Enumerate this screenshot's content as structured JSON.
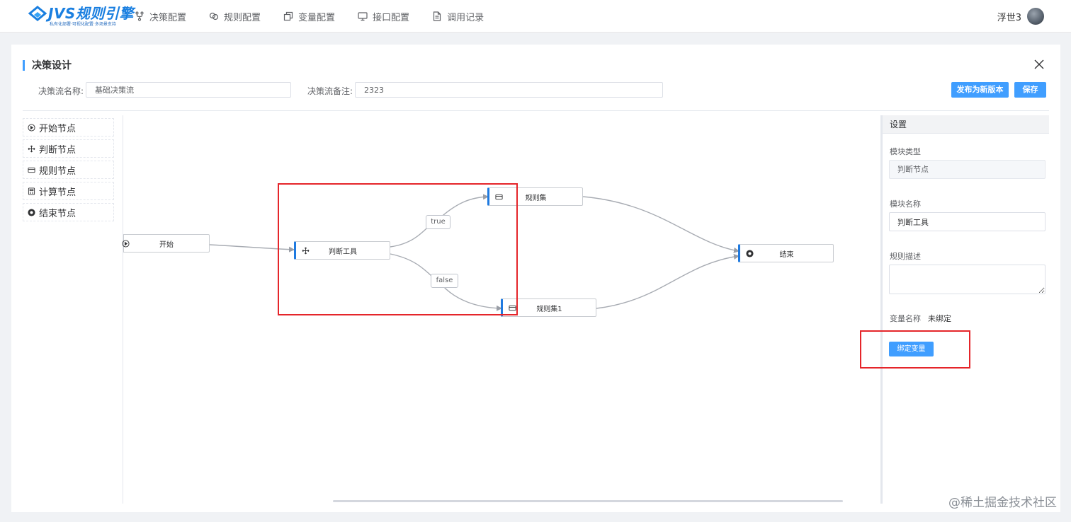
{
  "header": {
    "logo_title": "JVS规则引擎",
    "logo_subtitle": "私有化部署·可视化配置·多场景支持",
    "nav": [
      {
        "label": "决策配置",
        "icon": "fork-icon"
      },
      {
        "label": "规则配置",
        "icon": "link-icon"
      },
      {
        "label": "变量配置",
        "icon": "layers-icon"
      },
      {
        "label": "接口配置",
        "icon": "monitor-icon"
      },
      {
        "label": "调用记录",
        "icon": "document-icon"
      }
    ],
    "user_name": "浮世3"
  },
  "dialog": {
    "title": "决策设计",
    "flow_name_label": "决策流名称:",
    "flow_name_value": "基础决策流",
    "flow_note_label": "决策流备注:",
    "flow_note_value": "2323",
    "publish_label": "发布为新版本",
    "save_label": "保存"
  },
  "palette": [
    {
      "label": "开始节点",
      "icon": "play-circle-icon"
    },
    {
      "label": "判断节点",
      "icon": "move-icon"
    },
    {
      "label": "规则节点",
      "icon": "card-icon"
    },
    {
      "label": "计算节点",
      "icon": "calculator-icon"
    },
    {
      "label": "结束节点",
      "icon": "stop-circle-icon"
    }
  ],
  "flow": {
    "nodes": [
      {
        "id": "start",
        "label": "开始",
        "icon": "play-circle-icon"
      },
      {
        "id": "judge",
        "label": "判断工具",
        "icon": "move-icon"
      },
      {
        "id": "rules",
        "label": "规则集",
        "icon": "card-icon"
      },
      {
        "id": "rules1",
        "label": "规则集1",
        "icon": "card-icon"
      },
      {
        "id": "end",
        "label": "结束",
        "icon": "stop-circle-icon"
      }
    ],
    "edges": [
      {
        "from": "start",
        "to": "judge",
        "label": ""
      },
      {
        "from": "judge",
        "to": "rules",
        "label": "true"
      },
      {
        "from": "judge",
        "to": "rules1",
        "label": "false"
      },
      {
        "from": "rules",
        "to": "end",
        "label": ""
      },
      {
        "from": "rules1",
        "to": "end",
        "label": ""
      }
    ]
  },
  "settings": {
    "header": "设置",
    "module_type_label": "模块类型",
    "module_type_value": "判断节点",
    "module_name_label": "模块名称",
    "module_name_value": "判断工具",
    "rule_desc_label": "规则描述",
    "rule_desc_value": "",
    "var_name_label": "变量名称",
    "var_name_value": "未绑定",
    "bind_button_label": "绑定变量"
  },
  "watermark": "@稀土掘金技术社区",
  "colors": {
    "primary": "#409eff",
    "node_accent": "#1f7ae0",
    "annotation": "#e5252a"
  }
}
